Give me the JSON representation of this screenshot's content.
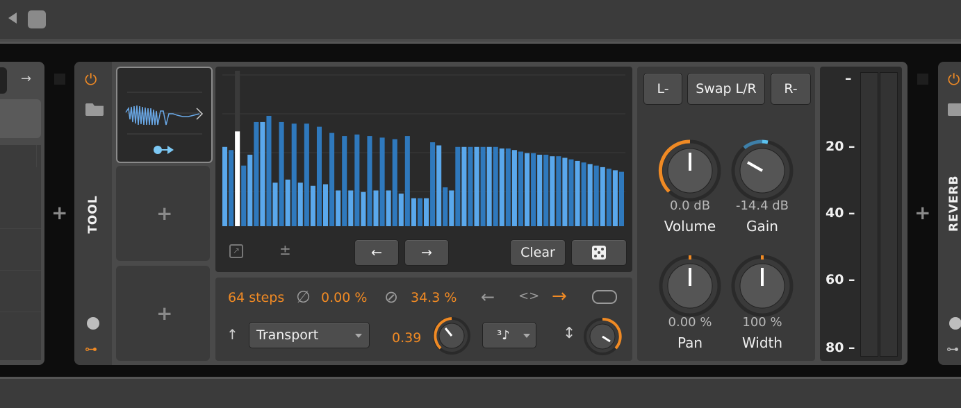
{
  "window": {
    "back_icon": "triangle-left-icon"
  },
  "device": {
    "name": "TOOL",
    "next_device_name": "REVERB",
    "swap_buttons": {
      "left": "L-",
      "swap": "Swap L/R",
      "right": "R-"
    },
    "knobs": [
      {
        "id": "volume",
        "label": "Volume",
        "value": "0.0 dB"
      },
      {
        "id": "gain",
        "label": "Gain",
        "value": "-14.4 dB"
      },
      {
        "id": "pan",
        "label": "Pan",
        "value": "0.00 %"
      },
      {
        "id": "width",
        "label": "Width",
        "value": "100 %"
      }
    ],
    "meter_ticks": [
      "–",
      "20 –",
      "40 –",
      "60 –",
      "80 –"
    ]
  },
  "sequencer": {
    "steps_label": "64 steps",
    "phase_value": "0.00 %",
    "skew_value": "34.3 %",
    "rate_value": "0.39",
    "transport_select": "Transport",
    "note_value_icon": "triplet-eighth-note-icon",
    "buttons": {
      "prev": "←",
      "next": "→",
      "clear": "Clear",
      "randomize": "dice-icon"
    },
    "plus_minus": "±",
    "direction_left": "←",
    "direction_both": "<>",
    "direction_right": "→",
    "add_slot": "+",
    "bar_values": [
      0.51,
      0.49,
      0.61,
      0.39,
      0.46,
      0.67,
      0.67,
      0.71,
      0.28,
      0.67,
      0.3,
      0.66,
      0.28,
      0.66,
      0.26,
      0.64,
      0.27,
      0.6,
      0.23,
      0.58,
      0.23,
      0.59,
      0.22,
      0.58,
      0.23,
      0.57,
      0.23,
      0.56,
      0.21,
      0.58,
      0.18,
      0.18,
      0.18,
      0.54,
      0.52,
      0.25,
      0.23,
      0.51,
      0.51,
      0.51,
      0.51,
      0.51,
      0.51,
      0.51,
      0.5,
      0.5,
      0.49,
      0.48,
      0.47,
      0.47,
      0.46,
      0.46,
      0.45,
      0.45,
      0.44,
      0.43,
      0.42,
      0.41,
      0.4,
      0.39,
      0.38,
      0.37,
      0.36,
      0.35
    ],
    "playhead_step": 2
  }
}
